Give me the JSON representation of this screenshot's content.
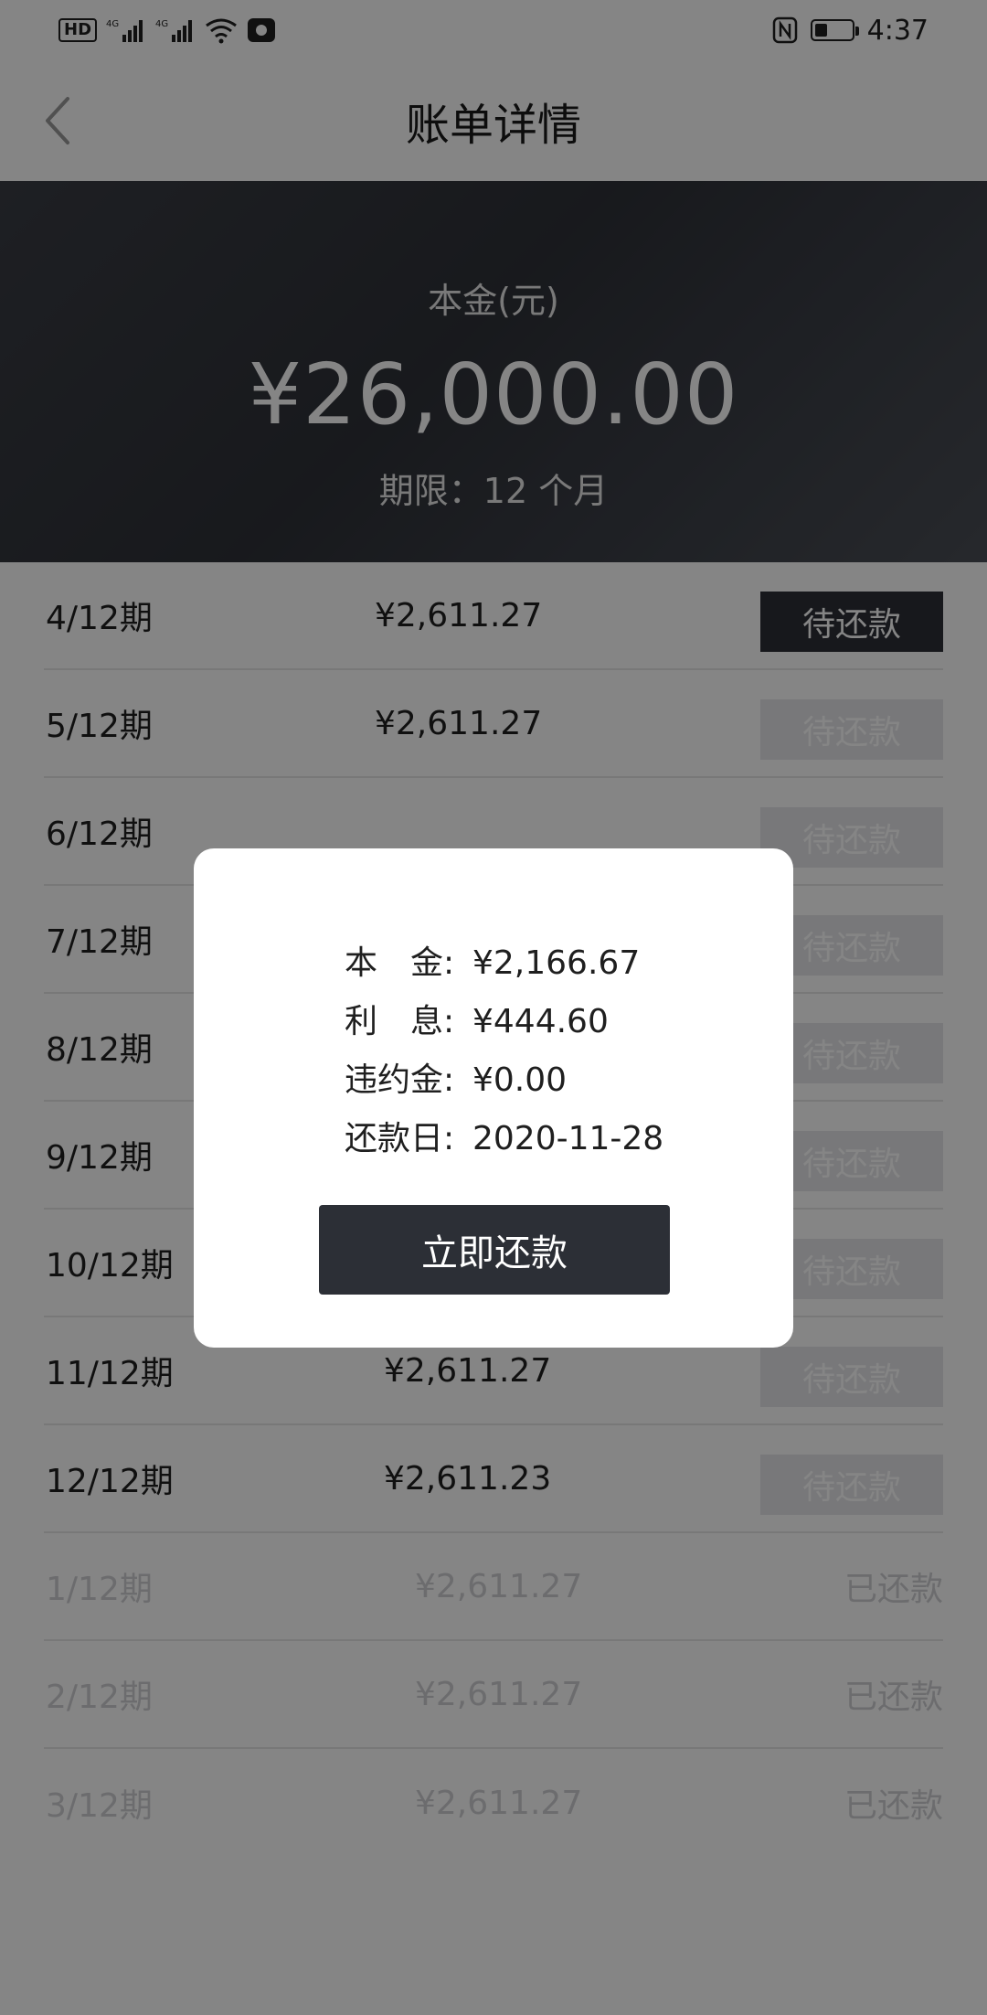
{
  "status_bar": {
    "hd": "HD",
    "sim_label_1": "4G",
    "sim_label_2": "4G",
    "time": "4:37",
    "battery_level_pct": 35
  },
  "header": {
    "title": "账单详情"
  },
  "hero": {
    "label": "本金(元)",
    "amount": "¥26,000.00",
    "term": "期限：12 个月"
  },
  "installments": [
    {
      "period": "4/12期",
      "amount": "¥2,611.27",
      "status": "待还款",
      "state": "active"
    },
    {
      "period": "5/12期",
      "amount": "¥2,611.27",
      "status": "待还款",
      "state": "pending"
    },
    {
      "period": "6/12期",
      "amount": "",
      "status": "待还款",
      "state": "pending"
    },
    {
      "period": "7/12期",
      "amount": "",
      "status": "待还款",
      "state": "pending"
    },
    {
      "period": "8/12期",
      "amount": "",
      "status": "待还款",
      "state": "pending"
    },
    {
      "period": "9/12期",
      "amount": "",
      "status": "待还款",
      "state": "pending"
    },
    {
      "period": "10/12期",
      "amount": "",
      "status": "待还款",
      "state": "pending"
    },
    {
      "period": "11/12期",
      "amount": "¥2,611.27",
      "status": "待还款",
      "state": "pending"
    },
    {
      "period": "12/12期",
      "amount": "¥2,611.23",
      "status": "待还款",
      "state": "pending"
    },
    {
      "period": "1/12期",
      "amount": "¥2,611.27",
      "status": "已还款",
      "state": "paid"
    },
    {
      "period": "2/12期",
      "amount": "¥2,611.27",
      "status": "已还款",
      "state": "paid"
    },
    {
      "period": "3/12期",
      "amount": "¥2,611.27",
      "status": "已还款",
      "state": "paid"
    }
  ],
  "dialog": {
    "principal_label": "本　金:",
    "principal_value": "¥2,166.67",
    "interest_label": "利　息:",
    "interest_value": "¥444.60",
    "penalty_label": "违约金:",
    "penalty_value": "¥0.00",
    "due_label": "还款日:",
    "due_value": "2020-11-28",
    "pay_button": "立即还款"
  }
}
